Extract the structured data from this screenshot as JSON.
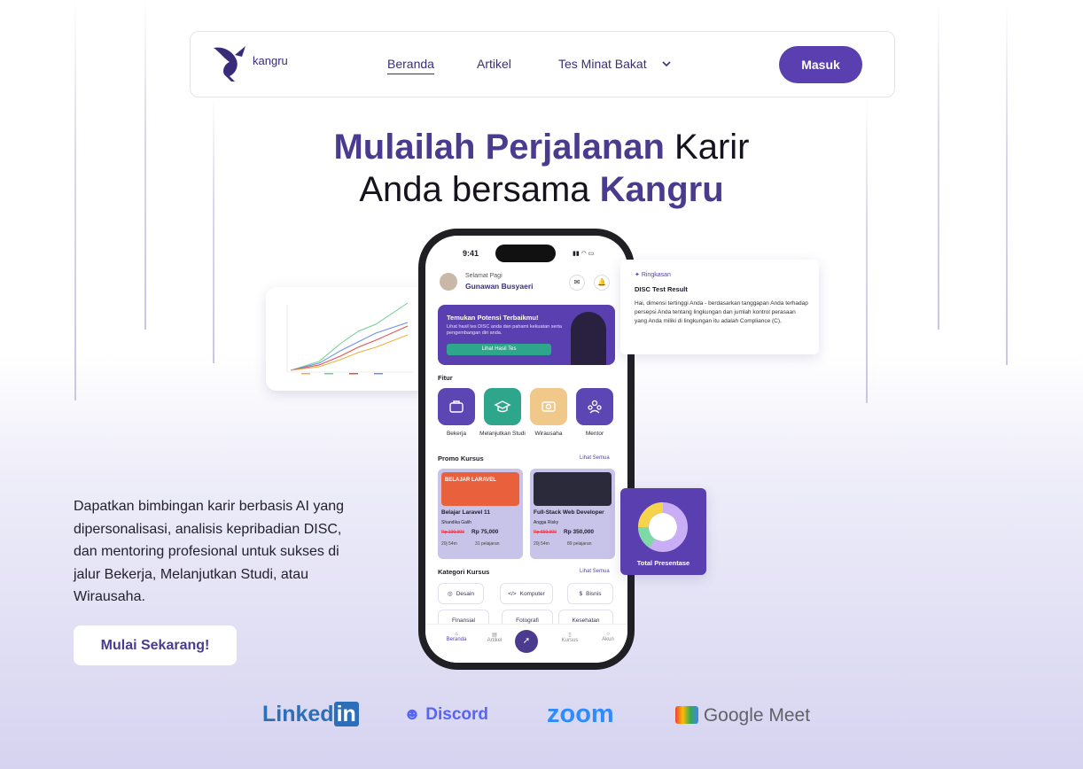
{
  "nav": {
    "logo_text": "kangru",
    "links": [
      "Beranda",
      "Artikel",
      "Tes Minat Bakat"
    ],
    "login_label": "Masuk"
  },
  "hero": {
    "title_part1": "Mulailah Perjalanan",
    "title_part2": " Karir",
    "title_part3": "Anda bersama ",
    "title_part4": "Kangru",
    "description": "Dapatkan bimbingan karir berbasis AI yang dipersonalisasi, analisis kepribadian DISC, dan mentoring profesional untuk sukses di jalur Bekerja, Melanjutkan Studi, atau Wirausaha.",
    "cta_label": "Mulai Sekarang!"
  },
  "phone": {
    "time": "9:41",
    "greeting": "Selamat Pagi",
    "user_name": "Gunawan Busyaeri",
    "banner": {
      "title": "Temukan Potensi Terbaikmu!",
      "text": "Lihat hasil tes DISC anda dan pahami kekuatan serta pengembangan diri anda.",
      "button": "Lihat Hasil Tes"
    },
    "features_title": "Fitur",
    "features": [
      "Bekerja",
      "Melanjutkan Studi",
      "Wirausaha",
      "Mentor"
    ],
    "promo_title": "Promo Kursus",
    "see_all": "Lihat Semua",
    "courses": [
      {
        "thumb": "BELAJAR LARAVEL",
        "title": "Belajar Laravel 11",
        "author": "Shandika Galih",
        "old_price": "Rp 100,000",
        "price": "Rp 75,000",
        "duration": "20j 54m",
        "lessons": "31 pelajaran"
      },
      {
        "thumb": "",
        "title": "Full-Stack Web Developer",
        "author": "Angga Risky",
        "old_price": "Rp 650,000",
        "price": "Rp 350,000",
        "duration": "20j 54m",
        "lessons": "89 pelajaran"
      }
    ],
    "category_title": "Kategori Kursus",
    "categories": [
      "Desain",
      "Komputer",
      "Bisnis",
      "Finansial",
      "Fotografi",
      "Kesehatan"
    ],
    "tabs": [
      "Beranda",
      "Artikel",
      "",
      "Kursus",
      "Akun"
    ]
  },
  "summary_card": {
    "tag": "Ringkasan",
    "title": "DISC Test Result",
    "text": "Hai, dimensi tertinggi Anda - berdasarkan tanggapan Anda terhadap persepsi Anda tentang lingkungan dan jumlah kontrol perasaan yang Anda miliki di lingkungan itu adalah Compliance (C)."
  },
  "donut_card": {
    "label": "Total Presentase"
  },
  "brands": [
    "LinkedIn",
    "Discord",
    "zoom",
    "Google Meet"
  ],
  "colors": {
    "primary": "#5a3fb0",
    "title_purple": "#4b3b8f",
    "bekerja": "#5b46b3",
    "studi": "#2ea68c",
    "wirausaha": "#f0c98a",
    "mentor": "#5b46b3"
  }
}
